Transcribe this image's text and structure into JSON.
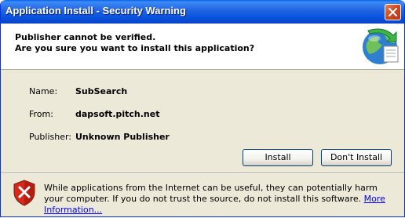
{
  "window": {
    "title": "Application Install - Security Warning"
  },
  "header": {
    "line1": "Publisher cannot be verified.",
    "line2": "Are you sure you want to install this application?"
  },
  "fields": [
    {
      "label": "Name:",
      "value": "SubSearch"
    },
    {
      "label": "From:",
      "value": "dapsoft.pitch.net"
    },
    {
      "label": "Publisher:",
      "value": "Unknown Publisher"
    }
  ],
  "buttons": {
    "install": "Install",
    "dont_install": "Don't Install"
  },
  "warning": {
    "text": "While applications from the Internet can be useful, they can potentially harm your computer. If you do not trust the source, do not install this software.",
    "link": "More Information..."
  },
  "icons": {
    "header": "globe-arrow-icon",
    "warning": "shield-warning-icon",
    "close": "close-icon"
  }
}
